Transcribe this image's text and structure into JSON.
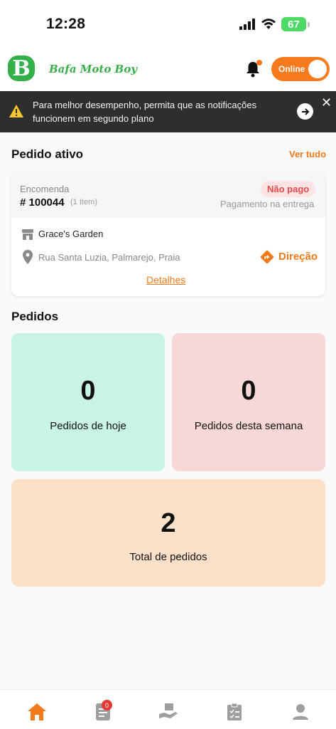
{
  "status_bar": {
    "time": "12:28",
    "battery": "67"
  },
  "header": {
    "brand": "Bafa Moto Boy",
    "logo_letter": "B",
    "toggle_label": "Online",
    "accent": "#f77a1c"
  },
  "banner": {
    "message": "Para melhor desempenho, permita que as notificações funcionem em segundo plano"
  },
  "active_order": {
    "section_title": "Pedido ativo",
    "see_all": "Ver tudo",
    "type_label": "Encomenda",
    "order_id": "# 100044",
    "items": "(1 Item)",
    "status": "Não pago",
    "payment": "Pagamento na entrega",
    "store": "Grace's Garden",
    "address": "Rua Santa Luzia, Palmarejo, Praia",
    "direction": "Direção",
    "details": "Detalhes"
  },
  "orders": {
    "section_title": "Pedidos",
    "today": {
      "value": "0",
      "label": "Pedidos de hoje",
      "color": "#c9f3e6"
    },
    "week": {
      "value": "0",
      "label": "Pedidos desta semana",
      "color": "#f8d7d7"
    },
    "total": {
      "value": "2",
      "label": "Total de pedidos",
      "color": "#fde0c8"
    }
  },
  "tab_bar": {
    "items": [
      "home-icon",
      "orders-icon",
      "delivery-icon",
      "clipboard-icon",
      "profile-icon"
    ],
    "badge": "0"
  }
}
